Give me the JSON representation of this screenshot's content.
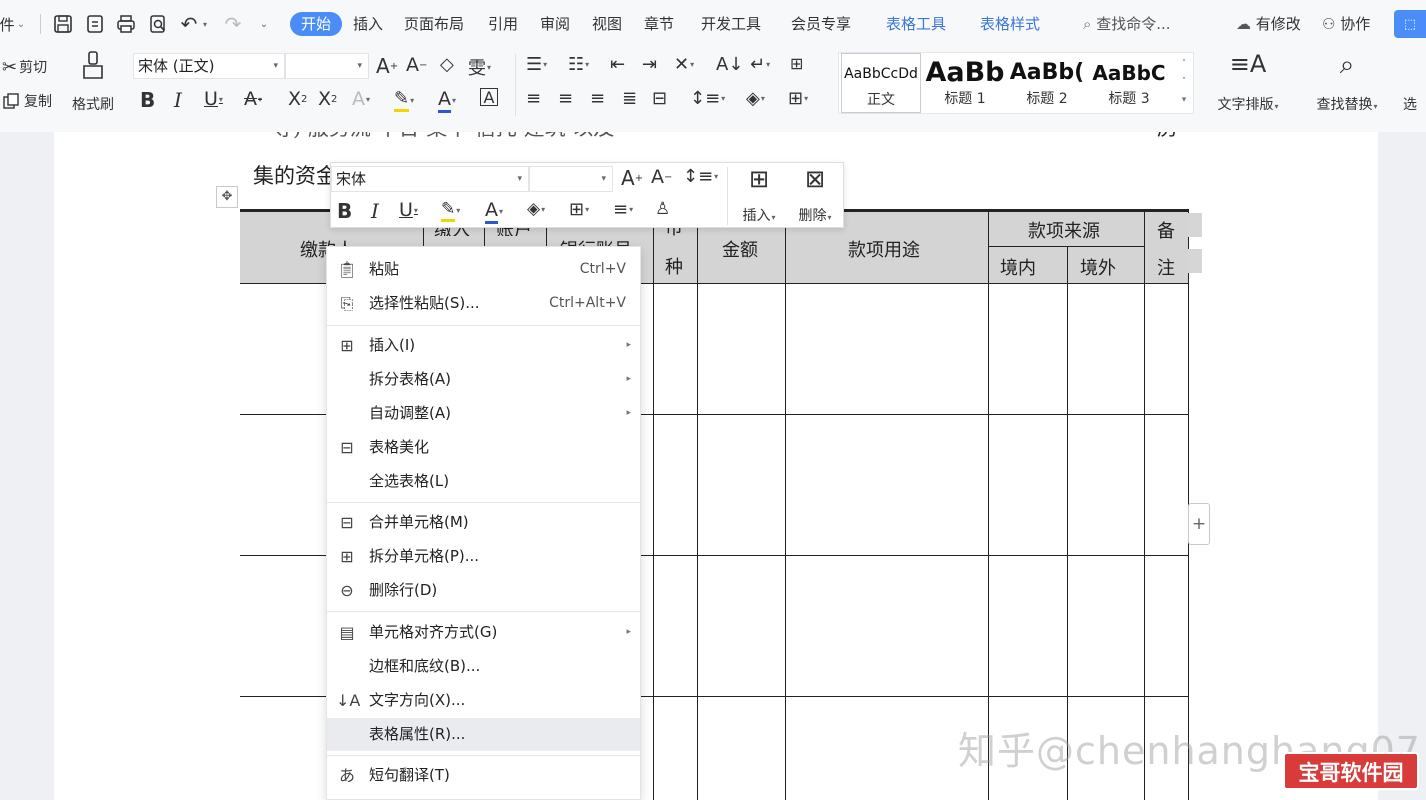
{
  "menubar": {
    "file_partial": "件",
    "tabs": [
      "开始",
      "插入",
      "页面布局",
      "引用",
      "审阅",
      "视图",
      "章节",
      "开发工具",
      "会员专享"
    ],
    "tool_tabs": [
      "表格工具",
      "表格样式"
    ],
    "search_placeholder": "查找命令...",
    "status": "有修改",
    "collab": "协作"
  },
  "ribbon": {
    "cut": "剪切",
    "copy": "复制",
    "format_painter": "格式刷",
    "font_name": "宋体 (正文)",
    "font_size": "",
    "styles": [
      {
        "sample": "AaBbCcDd",
        "name": "正文"
      },
      {
        "sample": "AaBb",
        "name": "标题 1"
      },
      {
        "sample": "AaBb(",
        "name": "标题 2"
      },
      {
        "sample": "AaBbC",
        "name": "标题 3"
      }
    ],
    "text_layout": "文字排版",
    "find_replace": "查找替换",
    "select_partial": "选"
  },
  "doc": {
    "line_top_partial": "等)    服务流    平台    集中      信托    建筑     以及",
    "line_top_end": "房",
    "line2": "集的资金",
    "table_headers": {
      "payer": "缴款人",
      "col2": "缴入",
      "col3": "账户",
      "col4": "银行账号",
      "currency_top": "币",
      "currency_bottom": "种",
      "amount": "金额",
      "purpose": "款项用途",
      "source": "款项来源",
      "domestic": "境内",
      "foreign": "境外",
      "remark_top": "备",
      "remark_bottom": "注"
    }
  },
  "minibar": {
    "font_name": "宋体",
    "font_size": "",
    "insert_label": "插入",
    "delete_label": "删除"
  },
  "context_menu": {
    "items": [
      {
        "label": "粘贴",
        "shortcut": "Ctrl+V"
      },
      {
        "label": "选择性粘贴(S)...",
        "shortcut": "Ctrl+Alt+V"
      },
      {
        "label": "插入(I)"
      },
      {
        "label": "拆分表格(A)"
      },
      {
        "label": "自动调整(A)"
      },
      {
        "label": "表格美化"
      },
      {
        "label": "全选表格(L)"
      },
      {
        "label": "合并单元格(M)"
      },
      {
        "label": "拆分单元格(P)..."
      },
      {
        "label": "删除行(D)"
      },
      {
        "label": "单元格对齐方式(G)"
      },
      {
        "label": "边框和底纹(B)..."
      },
      {
        "label": "文字方向(X)..."
      },
      {
        "label": "表格属性(R)..."
      },
      {
        "label": "短句翻译(T)"
      }
    ]
  },
  "watermark": "知乎@chenhanghang07",
  "badge": "宝哥软件园"
}
